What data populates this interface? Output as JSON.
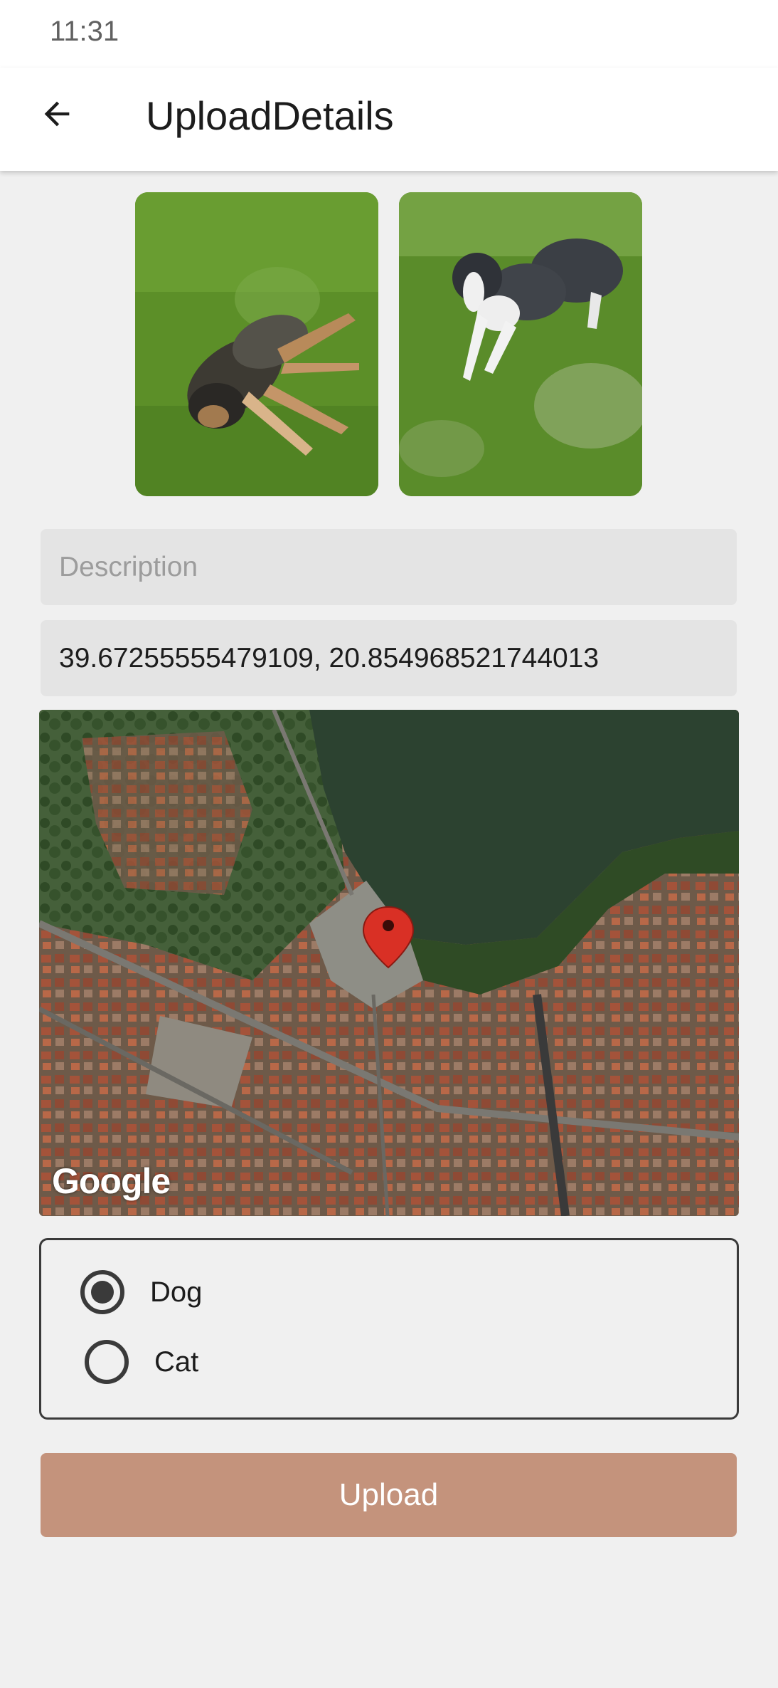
{
  "status_bar": {
    "time": "11:31"
  },
  "app_bar": {
    "title": "UploadDetails",
    "back_icon": "arrow-back-icon"
  },
  "photos": [
    {
      "name": "dog-photo-1"
    },
    {
      "name": "dog-photo-2"
    }
  ],
  "description": {
    "placeholder": "Description",
    "value": ""
  },
  "location": {
    "value": "39.67255555479109, 20.854968521744013"
  },
  "map": {
    "attribution": "Google",
    "marker_color": "#d93025"
  },
  "animal_type": {
    "options": [
      {
        "label": "Dog",
        "selected": true
      },
      {
        "label": "Cat",
        "selected": false
      }
    ]
  },
  "upload_button": {
    "label": "Upload",
    "color": "#c4937c"
  }
}
